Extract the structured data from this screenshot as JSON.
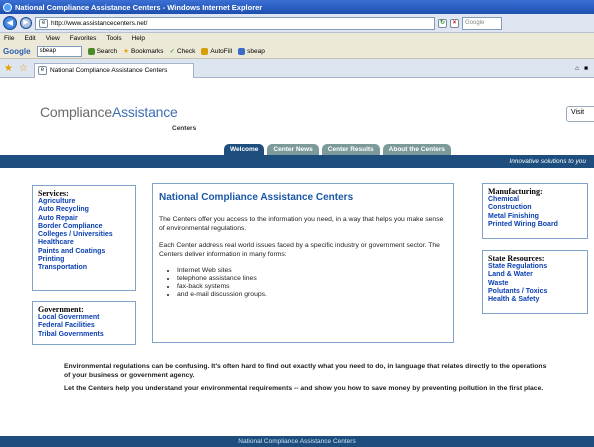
{
  "window": {
    "title": "National Compliance Assistance Centers - Windows Internet Explorer"
  },
  "address_bar": {
    "url": "http://www.assistancecenters.net/",
    "search_placeholder": "Google"
  },
  "menu": [
    "File",
    "Edit",
    "View",
    "Favorites",
    "Tools",
    "Help"
  ],
  "google_toolbar": {
    "logo": "Google",
    "query": "sbeap",
    "items": [
      "Search",
      "Bookmarks",
      "Check",
      "AutoFill",
      "sbeap"
    ]
  },
  "tab": {
    "label": "National Compliance Assistance Centers"
  },
  "page": {
    "logo_main": "Compliance",
    "logo_accent": "Assistance",
    "logo_sub": "Centers",
    "visit_label": "Visit",
    "nav": [
      "Welcome",
      "Center News",
      "Center Results",
      "About the Centers"
    ],
    "tagline": "Innovative solutions to you",
    "services": {
      "heading": "Services:",
      "links": [
        "Agriculture",
        "Auto Recycling",
        "Auto Repair",
        "Border Compliance",
        "Colleges / Universities",
        "Healthcare",
        "Paints and Coatings",
        "Printing",
        "Transportation"
      ]
    },
    "government": {
      "heading": "Government:",
      "links": [
        "Local Government",
        "Federal Facilities",
        "Tribal Governments"
      ]
    },
    "manufacturing": {
      "heading": "Manufacturing:",
      "links": [
        "Chemical",
        "Construction",
        "Metal Finishing",
        "Printed Wiring Board"
      ]
    },
    "state_resources": {
      "heading": "State Resources:",
      "links": [
        "State Regulations",
        "Land & Water",
        "Waste",
        "Polutants / Toxics",
        "Health & Safety"
      ]
    },
    "main": {
      "title": "National Compliance Assistance Centers",
      "p1": "The Centers offer you access to the information you need, in a way that helps you make sense of environmental regulations.",
      "p2": "Each Center address real world issues faced by a specific industry or government sector. The Centers deliver information in many forms:",
      "list": [
        "Internet Web sites",
        "telephone assistance lines",
        "fax-back systems",
        "and e-mail discussion groups."
      ]
    },
    "bottom1": "Environmental regulations can be confusing. It's often hard to find out exactly what you need to do, in language that relates directly to the operations of your business or government agency.",
    "bottom2": "Let the Centers help you understand your environmental requirements -- and show you how to save money by preventing pollution in the first place.",
    "footer": "National Compliance Assistance Centers"
  }
}
